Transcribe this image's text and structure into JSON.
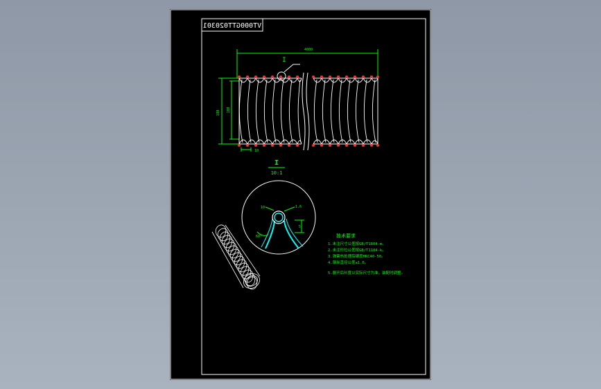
{
  "drawing": {
    "title_code": "VT000GTT020301",
    "detail_label": "I",
    "detail_scale": "10:1",
    "callout_label": "I",
    "length_dim": "4000",
    "height_dim_outer": "100",
    "height_dim_inner": "100",
    "pitch_dim": "10",
    "wire_label": "10",
    "thickness_label": "1.6",
    "gap_label": "5",
    "angle_label": "60°",
    "notes_title": "技术要求",
    "notes": [
      "1.未注尺寸公差按GB/T1804-m。",
      "2.未注形位公差按GB/T1184-k。",
      "3.弹簧热处理后硬度HRC40-50。",
      "4.钢丝直径公差±1.6。",
      "5.展开后长度以实际尺寸为准，装配时调整。"
    ]
  },
  "colors": {
    "frame": "#ffffff",
    "dimension": "#00ff00",
    "section": "#00ffff",
    "marker": "#ff2a2a"
  }
}
